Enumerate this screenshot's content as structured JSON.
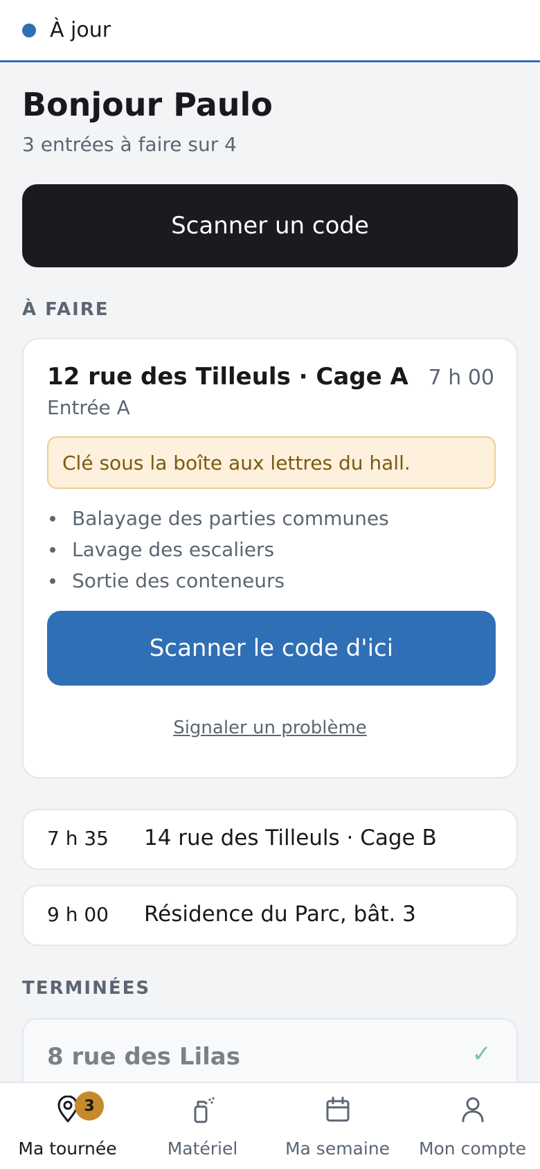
{
  "status": {
    "text": "À jour",
    "color": "#2f6fb5"
  },
  "header": {
    "greeting": "Bonjour Paulo",
    "subtitle": "3 entrées à faire sur 4"
  },
  "scan_button": {
    "label": "Scanner un code"
  },
  "sections": {
    "todo": "À FAIRE",
    "done": "TERMINÉES"
  },
  "current_entry": {
    "title": "12 rue des Tilleuls · Cage A",
    "time": "7 h 00",
    "subtitle": "Entrée A",
    "note": "Clé sous la boîte aux lettres du hall.",
    "tasks": [
      "Balayage des parties communes",
      "Lavage des escaliers",
      "Sortie des conteneurs"
    ],
    "scan_label": "Scanner le code d'ici",
    "report_label": "Signaler un problème"
  },
  "upcoming": [
    {
      "time": "7 h 35",
      "label": "14 rue des Tilleuls · Cage B"
    },
    {
      "time": "9 h 00",
      "label": "Résidence du Parc, bât. 3"
    }
  ],
  "done": [
    {
      "label": "8 rue des Lilas",
      "check": "✓"
    }
  ],
  "nav": {
    "items": [
      {
        "label": "Ma tournée",
        "icon": "map-pin-icon",
        "badge": "3",
        "active": true
      },
      {
        "label": "Matériel",
        "icon": "spray-bottle-icon",
        "active": false
      },
      {
        "label": "Ma semaine",
        "icon": "calendar-icon",
        "active": false
      },
      {
        "label": "Mon compte",
        "icon": "user-icon",
        "active": false
      }
    ]
  },
  "colors": {
    "accent": "#2f6fb5",
    "primary_button": "#191b1e",
    "badge": "#c58a2c",
    "note_bg": "#fdf0dc",
    "check": "#7fc4a2"
  }
}
